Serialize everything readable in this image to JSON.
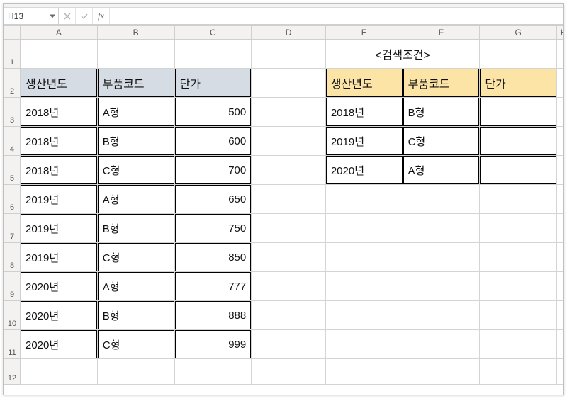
{
  "namebox": {
    "value": "H13"
  },
  "formula_bar": {
    "cancel_tooltip": "Cancel",
    "accept_tooltip": "Enter",
    "fx_label": "fx",
    "value": ""
  },
  "columns": [
    "A",
    "B",
    "C",
    "D",
    "E",
    "F",
    "G",
    "H"
  ],
  "row_headers": [
    "1",
    "2",
    "3",
    "4",
    "5",
    "6",
    "7",
    "8",
    "9",
    "10",
    "11",
    "12"
  ],
  "search_title": "<검색조건>",
  "left_table": {
    "headers": [
      "생산년도",
      "부품코드",
      "단가"
    ],
    "rows": [
      {
        "year": "2018년",
        "code": "A형",
        "price": "500"
      },
      {
        "year": "2018년",
        "code": "B형",
        "price": "600"
      },
      {
        "year": "2018년",
        "code": "C형",
        "price": "700"
      },
      {
        "year": "2019년",
        "code": "A형",
        "price": "650"
      },
      {
        "year": "2019년",
        "code": "B형",
        "price": "750"
      },
      {
        "year": "2019년",
        "code": "C형",
        "price": "850"
      },
      {
        "year": "2020년",
        "code": "A형",
        "price": "777"
      },
      {
        "year": "2020년",
        "code": "B형",
        "price": "888"
      },
      {
        "year": "2020년",
        "code": "C형",
        "price": "999"
      }
    ]
  },
  "right_table": {
    "headers": [
      "생산년도",
      "부품코드",
      "단가"
    ],
    "rows": [
      {
        "year": "2018년",
        "code": "B형",
        "price": ""
      },
      {
        "year": "2019년",
        "code": "C형",
        "price": ""
      },
      {
        "year": "2020년",
        "code": "A형",
        "price": ""
      }
    ]
  }
}
